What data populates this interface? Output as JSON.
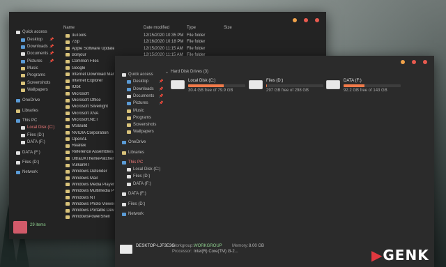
{
  "background": {
    "description_colors": [
      "#6e7976",
      "#27302f"
    ]
  },
  "window1": {
    "controls": {
      "colors": [
        "#f0a24a",
        "#e85a4f",
        "#e85a4f"
      ]
    },
    "nav": [
      {
        "label": "Quick access",
        "icon": "star-icon",
        "color": "#e0e0e0"
      },
      {
        "label": "Desktop",
        "icon": "desktop-icon",
        "color": "#5b9bd5",
        "pinned": true
      },
      {
        "label": "Downloads",
        "icon": "download-icon",
        "color": "#5b9bd5",
        "pinned": true
      },
      {
        "label": "Documents",
        "icon": "document-icon",
        "color": "#e0e0e0",
        "pinned": true
      },
      {
        "label": "Pictures",
        "icon": "pictures-icon",
        "color": "#5b9bd5",
        "pinned": true
      },
      {
        "label": "Music",
        "icon": "folder-icon",
        "color": "#d8c27a"
      },
      {
        "label": "Programs",
        "icon": "folder-icon",
        "color": "#d8c27a"
      },
      {
        "label": "Screenshots",
        "icon": "folder-icon",
        "color": "#d8c27a"
      },
      {
        "label": "Wallpapers",
        "icon": "folder-icon",
        "color": "#d8c27a"
      },
      {
        "label": "OneDrive",
        "icon": "cloud-icon",
        "color": "#5b9bd5"
      },
      {
        "label": "Libraries",
        "icon": "library-icon",
        "color": "#d8c27a"
      },
      {
        "label": "This PC",
        "icon": "computer-icon",
        "color": "#5b9bd5"
      },
      {
        "label": "Local Disk (C:)",
        "icon": "drive-icon",
        "color": "#e0e0e0",
        "selected": true
      },
      {
        "label": "Files (D:)",
        "icon": "drive-icon",
        "color": "#e0e0e0"
      },
      {
        "label": "DATA (F:)",
        "icon": "drive-icon",
        "color": "#e0e0e0"
      },
      {
        "label": "DATA (F:)",
        "icon": "drive-icon",
        "color": "#e0e0e0"
      },
      {
        "label": "Files (D:)",
        "icon": "drive-icon",
        "color": "#e0e0e0"
      },
      {
        "label": "Network",
        "icon": "network-icon",
        "color": "#5b9bd5"
      }
    ],
    "columns": {
      "name": "Name",
      "date": "Date modified",
      "type": "Type",
      "size": "Size"
    },
    "rows": [
      {
        "name": "3uTools",
        "date": "12/15/2020 10:35 PM",
        "type": "File folder"
      },
      {
        "name": "7zip",
        "date": "12/16/2020 10:18 PM",
        "type": "File folder"
      },
      {
        "name": "Apple Software Update",
        "date": "12/15/2020 11:15 AM",
        "type": "File folder"
      },
      {
        "name": "Bonjour",
        "date": "12/15/2020 11:15 AM",
        "type": "File folder"
      },
      {
        "name": "Common Files",
        "date": "",
        "type": ""
      },
      {
        "name": "Google",
        "date": "",
        "type": ""
      },
      {
        "name": "Internet Download Manager",
        "date": "",
        "type": ""
      },
      {
        "name": "Internet Explorer",
        "date": "",
        "type": ""
      },
      {
        "name": "IObit",
        "date": "",
        "type": ""
      },
      {
        "name": "Microsoft",
        "date": "",
        "type": ""
      },
      {
        "name": "Microsoft Office",
        "date": "",
        "type": ""
      },
      {
        "name": "Microsoft Silverlight",
        "date": "",
        "type": ""
      },
      {
        "name": "Microsoft XNA",
        "date": "",
        "type": ""
      },
      {
        "name": "Microsoft.NET",
        "date": "",
        "type": ""
      },
      {
        "name": "MSBuild",
        "date": "",
        "type": ""
      },
      {
        "name": "NVIDIA Corporation",
        "date": "",
        "type": ""
      },
      {
        "name": "OpenAL",
        "date": "",
        "type": ""
      },
      {
        "name": "Realtek",
        "date": "",
        "type": ""
      },
      {
        "name": "Reference Assemblies",
        "date": "",
        "type": ""
      },
      {
        "name": "UltraUXThemePatcher",
        "date": "",
        "type": ""
      },
      {
        "name": "VulkanRT",
        "date": "",
        "type": ""
      },
      {
        "name": "Windows Defender",
        "date": "",
        "type": ""
      },
      {
        "name": "Windows Mail",
        "date": "",
        "type": ""
      },
      {
        "name": "Windows Media Player",
        "date": "",
        "type": ""
      },
      {
        "name": "Windows Multimedia Platfo",
        "date": "",
        "type": ""
      },
      {
        "name": "Windows NT",
        "date": "",
        "type": ""
      },
      {
        "name": "Windows Photo Viewer",
        "date": "",
        "type": ""
      },
      {
        "name": "Windows Portable Devices",
        "date": "",
        "type": ""
      },
      {
        "name": "WindowsPowerShell",
        "date": "",
        "type": ""
      }
    ],
    "status": {
      "count": "29 items"
    }
  },
  "window2": {
    "controls": {
      "colors": [
        "#f0a24a",
        "#e85a4f",
        "#e85a4f"
      ]
    },
    "nav": [
      {
        "label": "Quick access",
        "icon": "star-icon",
        "color": "#e0e0e0"
      },
      {
        "label": "Desktop",
        "icon": "desktop-icon",
        "color": "#5b9bd5",
        "pinned": true
      },
      {
        "label": "Downloads",
        "icon": "download-icon",
        "color": "#5b9bd5",
        "pinned": true
      },
      {
        "label": "Documents",
        "icon": "document-icon",
        "color": "#e0e0e0",
        "pinned": true
      },
      {
        "label": "Pictures",
        "icon": "pictures-icon",
        "color": "#5b9bd5",
        "pinned": true
      },
      {
        "label": "Music",
        "icon": "folder-icon",
        "color": "#d8c27a"
      },
      {
        "label": "Programs",
        "icon": "folder-icon",
        "color": "#d8c27a"
      },
      {
        "label": "Screenshots",
        "icon": "folder-icon",
        "color": "#d8c27a"
      },
      {
        "label": "Wallpapers",
        "icon": "folder-icon",
        "color": "#d8c27a"
      },
      {
        "label": "OneDrive",
        "icon": "cloud-icon",
        "color": "#5b9bd5"
      },
      {
        "label": "Libraries",
        "icon": "library-icon",
        "color": "#d8c27a"
      },
      {
        "label": "This PC",
        "icon": "computer-icon",
        "color": "#5b9bd5",
        "selected": true
      },
      {
        "label": "Local Disk (C:)",
        "icon": "drive-icon",
        "color": "#e0e0e0"
      },
      {
        "label": "Files (D:)",
        "icon": "drive-icon",
        "color": "#e0e0e0"
      },
      {
        "label": "DATA (F:)",
        "icon": "drive-icon",
        "color": "#e0e0e0"
      },
      {
        "label": "DATA (F:)",
        "icon": "drive-icon",
        "color": "#e0e0e0"
      },
      {
        "label": "Files (D:)",
        "icon": "drive-icon",
        "color": "#e0e0e0"
      },
      {
        "label": "Network",
        "icon": "network-icon",
        "color": "#5b9bd5"
      }
    ],
    "section": "Hard Disk Drives (3)",
    "drives": [
      {
        "name": "Local Disk (C:)",
        "free": "30.4 GB free of 79.9 GB",
        "used_fraction": 0.62,
        "color": "#f07a4a"
      },
      {
        "name": "Files (D:)",
        "free": "297 GB free of 298 GB",
        "used_fraction": 0.01,
        "color": "#f07a4a"
      },
      {
        "name": "DATA (F:)",
        "free": "92.2 GB free of 143 GB",
        "used_fraction": 0.36,
        "color": "#f07a4a"
      }
    ],
    "details": {
      "computer": "DESKTOP-LJF3E3G",
      "workgroup_label": "Workgroup:",
      "workgroup": "WORKGROUP",
      "memory_label": "Memory:",
      "memory": "8.00 GB",
      "processor_label": "Processor:",
      "processor": "Intel(R) Core(TM) i3-2..."
    }
  },
  "watermark": "GENK"
}
